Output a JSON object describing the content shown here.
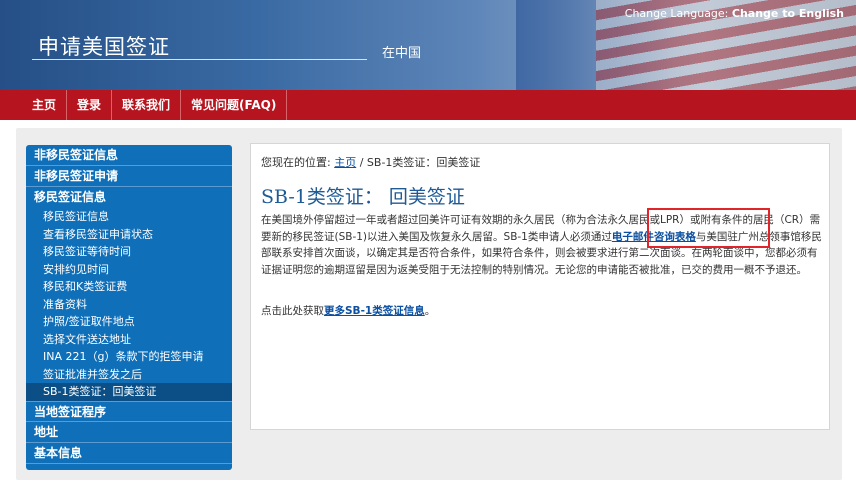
{
  "header": {
    "title": "申请美国签证",
    "subtitle": "在中国",
    "lang_label": "Change Language:",
    "lang_link": "Change to English"
  },
  "nav": {
    "items": [
      {
        "label": "主页"
      },
      {
        "label": "登录"
      },
      {
        "label": "联系我们"
      },
      {
        "label": "常见问题(FAQ)"
      }
    ]
  },
  "sidebar": {
    "sections": [
      {
        "label": "非移民签证信息"
      },
      {
        "label": "非移民签证申请"
      },
      {
        "label": "移民签证信息"
      }
    ],
    "subitems": [
      {
        "label": "移民签证信息"
      },
      {
        "label": "查看移民签证申请状态"
      },
      {
        "label": "移民签证等待时间"
      },
      {
        "label": "安排约见时间"
      },
      {
        "label": "移民和K类签证费"
      },
      {
        "label": "准备资料"
      },
      {
        "label": "护照/签证取件地点"
      },
      {
        "label": "选择文件送达地址"
      },
      {
        "label": "INA 221（g）条款下的拒签申请"
      },
      {
        "label": "签证批准并签发之后"
      },
      {
        "label": "SB-1类签证：回美签证"
      }
    ],
    "sections_after": [
      {
        "label": "当地签证程序"
      },
      {
        "label": "地址"
      },
      {
        "label": "基本信息"
      }
    ]
  },
  "content": {
    "breadcrumb_prefix": "您现在的位置:",
    "breadcrumb_home": "主页",
    "breadcrumb_rest": "/ SB-1类签证：回美签证",
    "heading": "SB-1类签证： 回美签证",
    "para_part1": "在美国境外停留超过一年或者超过回美许可证有效期的永久居民（称为合法永久居民或LPR）或附有条件的居民（CR）需要新的移民签证(SB-1)以进入美国及恢复永久居留。SB-1类申请人必须通过",
    "para_link": "电子邮件咨询表格",
    "para_part2": "与美国驻广州总领事馆移民部联系安排首次面谈，以确定其是否符合条件，如果符合条件，则会被要求进行第二次面谈。在两轮面谈中，您都必须有证据证明您的逾期逗留是因为返美受阻于无法控制的特别情况。无论您的申请能否被批准，已交的费用一概不予退还。",
    "more_prefix": "点击此处获取",
    "more_link": "更多SB-1类签证信息",
    "more_suffix": "。"
  }
}
